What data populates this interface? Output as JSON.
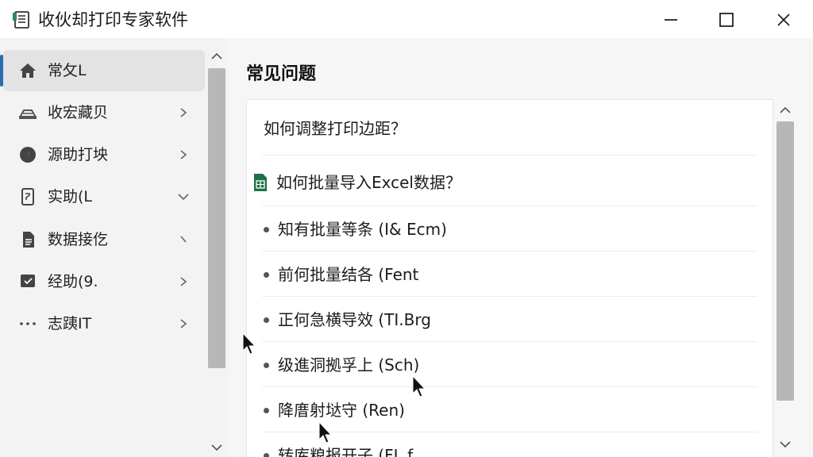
{
  "window": {
    "title": "收伙却打印专家软件"
  },
  "sidebar": {
    "items": [
      {
        "label": "常攵L",
        "icon": "home-icon",
        "active": true,
        "chevron": "none"
      },
      {
        "label": "收宏藏贝",
        "icon": "scanner-icon",
        "active": false,
        "chevron": "right"
      },
      {
        "label": "源助打坱",
        "icon": "compass-icon",
        "active": false,
        "chevron": "right"
      },
      {
        "label": "实助(L",
        "icon": "document-icon",
        "active": false,
        "chevron": "down"
      },
      {
        "label": "数据接仡",
        "icon": "file-icon",
        "active": false,
        "chevron": "collapsed"
      },
      {
        "label": "经助(9.",
        "icon": "chat-icon",
        "active": false,
        "chevron": "right"
      },
      {
        "label": "志跠IT",
        "icon": "more-icon",
        "active": false,
        "chevron": "right"
      }
    ]
  },
  "main": {
    "title": "常见问题",
    "questions": [
      {
        "text": "如何调整打印边距？",
        "style": "plain"
      },
      {
        "text": "如何批量导入Excel数据？",
        "style": "excel",
        "icon": "excel-icon"
      },
      {
        "text": "知有批量等条 (I& Ecm)",
        "style": "bullet"
      },
      {
        "text": "前何批量结各 (Fent",
        "style": "bullet"
      },
      {
        "text": "正何急横导效 (TI.Brg",
        "style": "bullet"
      },
      {
        "text": "级進洞拠孚上 (Sch)",
        "style": "bullet"
      },
      {
        "text": "降庴射垯守 (Ren)",
        "style": "bullet"
      },
      {
        "text": "转库粮报开子 (FL f",
        "style": "bullet"
      }
    ]
  },
  "colors": {
    "accent": "#2b6cb0",
    "excel_green": "#1e7145",
    "sidebar_bg": "#f3f3f3",
    "scroll_thumb": "#b7b7b7"
  }
}
